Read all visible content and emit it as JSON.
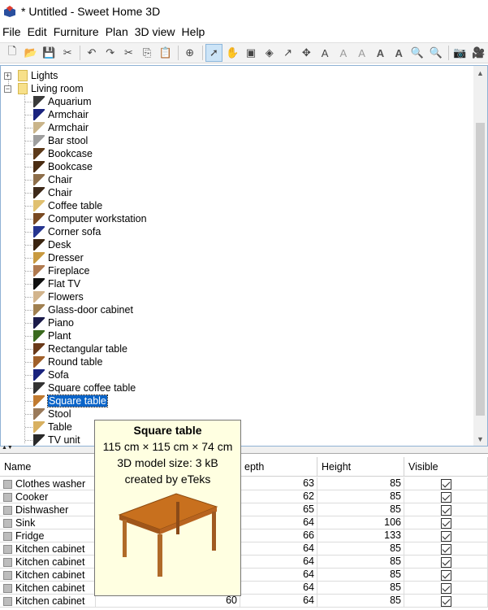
{
  "window": {
    "title": "* Untitled - Sweet Home 3D"
  },
  "menu": [
    "File",
    "Edit",
    "Furniture",
    "Plan",
    "3D view",
    "Help"
  ],
  "toolbar": {
    "buttons": [
      {
        "name": "new-home-icon",
        "glyph": "🗋"
      },
      {
        "name": "open-icon",
        "glyph": "📂"
      },
      {
        "name": "save-icon",
        "glyph": "💾"
      },
      {
        "name": "preferences-icon",
        "glyph": "✂"
      },
      {
        "sep": true
      },
      {
        "name": "undo-icon",
        "glyph": "↶"
      },
      {
        "name": "redo-icon",
        "glyph": "↷"
      },
      {
        "name": "cut-icon",
        "glyph": "✂"
      },
      {
        "name": "copy-icon",
        "glyph": "⎘"
      },
      {
        "name": "paste-icon",
        "glyph": "📋"
      },
      {
        "sep": true
      },
      {
        "name": "add-furniture-icon",
        "glyph": "⊕"
      },
      {
        "sep": true
      },
      {
        "name": "select-mode-icon",
        "glyph": "➚",
        "active": true
      },
      {
        "name": "pan-mode-icon",
        "glyph": "✋"
      },
      {
        "name": "create-walls-icon",
        "glyph": "▣"
      },
      {
        "name": "create-rooms-icon",
        "glyph": "◈"
      },
      {
        "name": "create-polylines-icon",
        "glyph": "↗"
      },
      {
        "name": "create-dimensions-icon",
        "glyph": "✥"
      },
      {
        "name": "add-text-icon",
        "glyph": "A"
      },
      {
        "name": "increase-text-size-icon",
        "glyph": "A",
        "dim": true
      },
      {
        "name": "decrease-text-size-icon",
        "glyph": "A",
        "dim": true
      },
      {
        "name": "bold-text-icon",
        "glyph": "A",
        "strong": true
      },
      {
        "name": "italic-text-icon",
        "glyph": "A",
        "strong": true
      },
      {
        "name": "zoom-in-icon",
        "glyph": "🔍"
      },
      {
        "name": "zoom-out-icon",
        "glyph": "🔍"
      },
      {
        "sep": true
      },
      {
        "name": "create-photo-icon",
        "glyph": "📷"
      },
      {
        "name": "create-video-icon",
        "glyph": "🎥"
      }
    ]
  },
  "catalog": {
    "categories": [
      {
        "label": "Lights",
        "expanded": false
      },
      {
        "label": "Living room",
        "expanded": true
      }
    ],
    "items": [
      {
        "label": "Aquarium",
        "color": "#3a3a3a"
      },
      {
        "label": "Armchair",
        "color": "#1a237e"
      },
      {
        "label": "Armchair",
        "color": "#c9b48a"
      },
      {
        "label": "Bar stool",
        "color": "#9e9e9e"
      },
      {
        "label": "Bookcase",
        "color": "#5d3a1a"
      },
      {
        "label": "Bookcase",
        "color": "#4a2c12"
      },
      {
        "label": "Chair",
        "color": "#8d6e4a"
      },
      {
        "label": "Chair",
        "color": "#3e2a1a"
      },
      {
        "label": "Coffee table",
        "color": "#e0c070"
      },
      {
        "label": "Computer workstation",
        "color": "#7a4a22"
      },
      {
        "label": "Corner sofa",
        "color": "#26358f"
      },
      {
        "label": "Desk",
        "color": "#3a2410"
      },
      {
        "label": "Dresser",
        "color": "#c89a40"
      },
      {
        "label": "Fireplace",
        "color": "#b07a50"
      },
      {
        "label": "Flat TV",
        "color": "#111111"
      },
      {
        "label": "Flowers",
        "color": "#d2b48c"
      },
      {
        "label": "Glass-door cabinet",
        "color": "#a08050"
      },
      {
        "label": "Piano",
        "color": "#1b1b4a"
      },
      {
        "label": "Plant",
        "color": "#3a6a1e"
      },
      {
        "label": "Rectangular table",
        "color": "#6a3a1a"
      },
      {
        "label": "Round table",
        "color": "#a0602a"
      },
      {
        "label": "Sofa",
        "color": "#1a237e"
      },
      {
        "label": "Square coffee table",
        "color": "#333333"
      },
      {
        "label": "Square table",
        "color": "#c07a30",
        "selected": true
      },
      {
        "label": "Stool",
        "color": "#9a7a5a"
      },
      {
        "label": "Table",
        "color": "#d8b060"
      },
      {
        "label": "TV unit",
        "color": "#2a2a2a"
      }
    ]
  },
  "tooltip": {
    "title": "Square table",
    "dimensions": "115 cm × 115 cm × 74 cm",
    "model_size": "3D model size: 3 kB",
    "creator": "created by eTeks"
  },
  "furniture_table": {
    "columns": [
      "Name",
      "",
      "Depth",
      "Height",
      "Visible"
    ],
    "column_labels": [
      "Name",
      "epth",
      "Height",
      "Visible"
    ],
    "rows": [
      {
        "name": "Clothes washer",
        "width": "",
        "depth": "63",
        "height": "85",
        "visible": true
      },
      {
        "name": "Cooker",
        "width": "",
        "depth": "62",
        "height": "85",
        "visible": true
      },
      {
        "name": "Dishwasher",
        "width": "",
        "depth": "65",
        "height": "85",
        "visible": true
      },
      {
        "name": "Sink",
        "width": "",
        "depth": "64",
        "height": "106",
        "visible": true
      },
      {
        "name": "Fridge",
        "width": "",
        "depth": "66",
        "height": "133",
        "visible": true
      },
      {
        "name": "Kitchen cabinet",
        "width": "",
        "depth": "64",
        "height": "85",
        "visible": true
      },
      {
        "name": "Kitchen cabinet",
        "width": "",
        "depth": "64",
        "height": "85",
        "visible": true
      },
      {
        "name": "Kitchen cabinet",
        "width": "",
        "depth": "64",
        "height": "85",
        "visible": true
      },
      {
        "name": "Kitchen cabinet",
        "width": "",
        "depth": "64",
        "height": "85",
        "visible": true
      },
      {
        "name": "Kitchen cabinet",
        "width": "60",
        "depth": "64",
        "height": "85",
        "visible": true
      }
    ]
  }
}
